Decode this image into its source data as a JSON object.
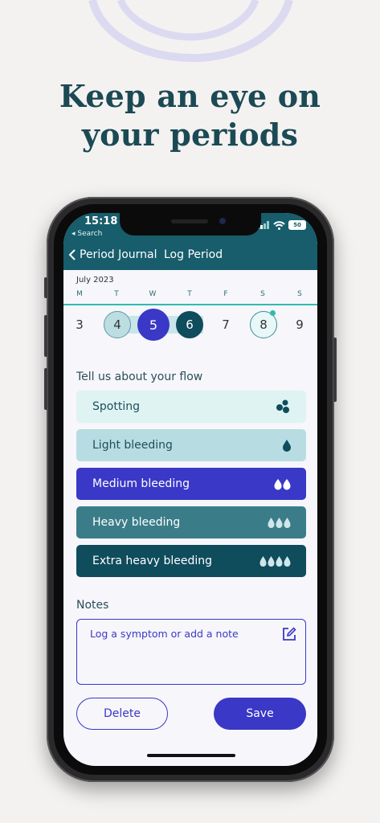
{
  "headline": {
    "line1": "Keep an eye on",
    "line2": "your periods"
  },
  "status": {
    "time": "15:18",
    "back_app": "◂ Search",
    "battery": "50"
  },
  "nav": {
    "back_label": "Period Journal",
    "title": "Log Period"
  },
  "calendar": {
    "month": "July 2023",
    "weekdays": [
      "M",
      "T",
      "W",
      "T",
      "F",
      "S",
      "S"
    ],
    "days": [
      "3",
      "4",
      "5",
      "6",
      "7",
      "8",
      "9"
    ]
  },
  "flow": {
    "label": "Tell us about your flow",
    "options": [
      {
        "label": "Spotting",
        "icon": "spotting-icon",
        "bg": "#dff3f3",
        "fg": "#1d4f5a"
      },
      {
        "label": "Light bleeding",
        "icon": "one-drop-icon",
        "bg": "#b7dde3",
        "fg": "#1d4f5a"
      },
      {
        "label": "Medium bleeding",
        "icon": "two-drops-icon",
        "bg": "#3a38c6",
        "fg": "#ffffff"
      },
      {
        "label": "Heavy bleeding",
        "icon": "three-drops-icon",
        "bg": "#3a7d89",
        "fg": "#ffffff"
      },
      {
        "label": "Extra heavy bleeding",
        "icon": "four-drops-icon",
        "bg": "#0f4c5c",
        "fg": "#ffffff"
      }
    ]
  },
  "notes": {
    "label": "Notes",
    "placeholder": "Log a symptom or add a note"
  },
  "actions": {
    "delete_label": "Delete",
    "save_label": "Save"
  },
  "colors": {
    "accent": "#3a38c6",
    "teal_header": "#175d6b",
    "headline": "#1b4a55"
  }
}
